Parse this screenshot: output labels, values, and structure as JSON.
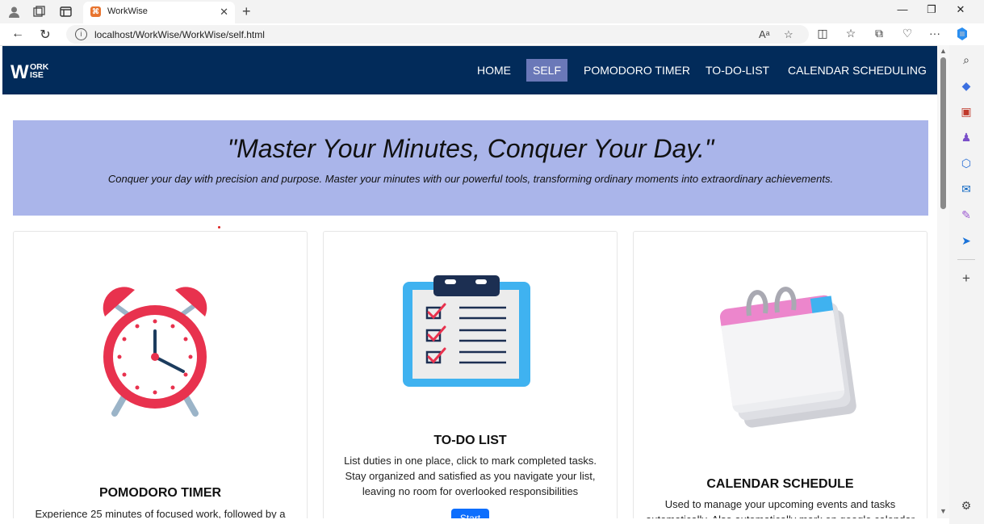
{
  "browser": {
    "tab_title": "WorkWise",
    "url": "localhost/WorkWise/WorkWise/self.html"
  },
  "site": {
    "logo": "WORK WISE",
    "nav": [
      {
        "label": "HOME"
      },
      {
        "label": "SELF"
      },
      {
        "label": "POMODORO TIMER"
      },
      {
        "label": "TO-DO-LIST"
      },
      {
        "label": "CALENDAR SCHEDULING"
      }
    ]
  },
  "hero": {
    "quote": "\"Master Your Minutes, Conquer Your Day.\"",
    "subtitle": "Conquer your day with precision and purpose. Master your minutes with our powerful tools, transforming ordinary moments into extraordinary achievements."
  },
  "cards": [
    {
      "title": "POMODORO TIMER",
      "text": "Experience 25 minutes of focused work, followed by a"
    },
    {
      "title": "TO-DO LIST",
      "text": "List duties in one place, click to mark completed tasks. Stay organized and satisfied as you navigate your list, leaving no room for overlooked responsibilities",
      "button": "Start"
    },
    {
      "title": "CALENDAR SCHEDULE",
      "text": "Used to manage your upcoming events and tasks automatically. Also automatically mark on google calendar"
    }
  ],
  "colors": {
    "navbar": "#022b5a",
    "hero": "#aab5ea",
    "active": "#6a78b8",
    "button": "#0d6efd"
  }
}
